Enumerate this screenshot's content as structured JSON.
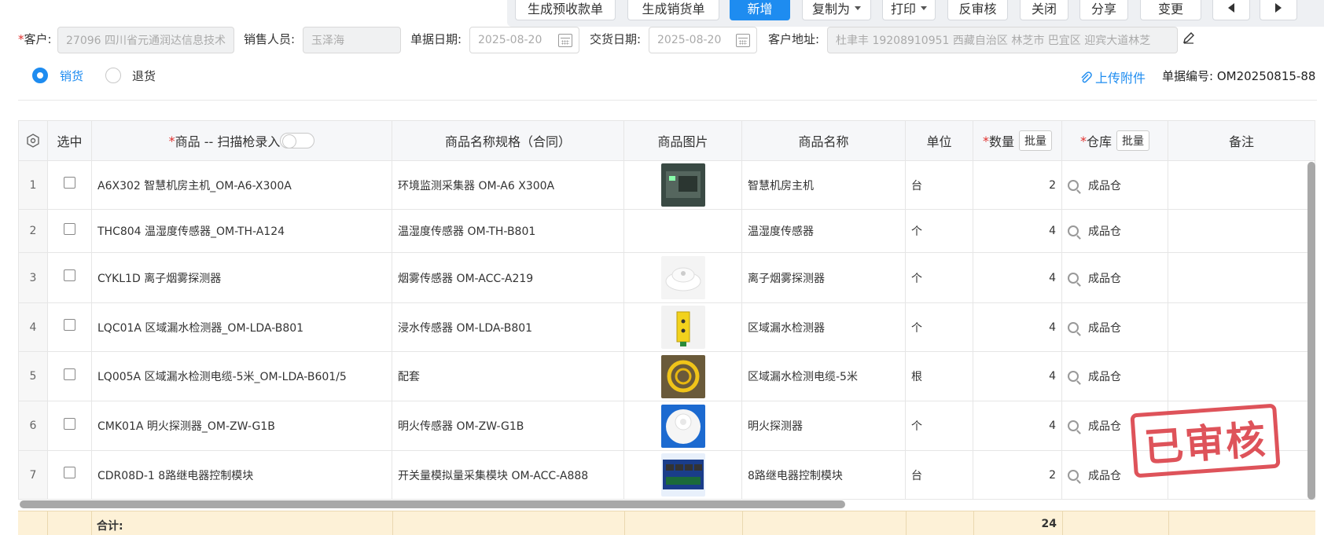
{
  "toolbar": {
    "gen_prereceipt": "生成预收款单",
    "gen_delivery": "生成销货单",
    "new": "新增",
    "copy_as": "复制为",
    "print": "打印",
    "unaudit": "反审核",
    "close": "关闭",
    "share": "分享",
    "change": "变更"
  },
  "form": {
    "customer_label": "客户:",
    "customer_value": "27096 四川省元通润达信息技术",
    "sales_label": "销售人员:",
    "sales_value": "玉泽海",
    "doc_date_label": "单据日期:",
    "doc_date_value": "2025-08-20",
    "delivery_date_label": "交货日期:",
    "delivery_date_value": "2025-08-20",
    "address_label": "客户地址:",
    "address_value": "杜聿丰 19208910951 西藏自治区 林芝市 巴宜区 迎宾大道林芝"
  },
  "mode": {
    "sale": "销货",
    "return": "退货",
    "selected": "sale"
  },
  "attach_label": "上传附件",
  "bill_no": "单据编号: OM20250815-88",
  "table": {
    "headers": {
      "select": "选中",
      "product": "商品 -- 扫描枪录入",
      "spec": "商品名称规格（合同）",
      "image": "商品图片",
      "name": "商品名称",
      "unit": "单位",
      "qty": "数量",
      "warehouse": "仓库",
      "remark": "备注",
      "batch": "批量"
    },
    "rows": [
      {
        "idx": "1",
        "product": "A6X302 智慧机房主机_OM-A6-X300A",
        "spec": "环境监测采集器 OM-A6 X300A",
        "name": "智慧机房主机",
        "unit": "台",
        "qty": "2",
        "warehouse": "成品仓",
        "image": "device-photo"
      },
      {
        "idx": "2",
        "product": "THC804 温湿度传感器_OM-TH-A124",
        "spec": "温湿度传感器 OM-TH-B801",
        "name": "温湿度传感器",
        "unit": "个",
        "qty": "4",
        "warehouse": "成品仓",
        "image": ""
      },
      {
        "idx": "3",
        "product": "CYKL1D 离子烟雾探测器",
        "spec": "烟雾传感器 OM-ACC-A219",
        "name": "离子烟雾探测器",
        "unit": "个",
        "qty": "4",
        "warehouse": "成品仓",
        "image": "smoke-detector-photo"
      },
      {
        "idx": "4",
        "product": "LQC01A 区域漏水检测器_OM-LDA-B801",
        "spec": "浸水传感器 OM-LDA-B801",
        "name": "区域漏水检测器",
        "unit": "个",
        "qty": "4",
        "warehouse": "成品仓",
        "image": "leak-detector-photo"
      },
      {
        "idx": "5",
        "product": "LQ005A 区域漏水检测电缆-5米_OM-LDA-B601/5",
        "spec": "配套",
        "name": "区域漏水检测电缆-5米",
        "unit": "根",
        "qty": "4",
        "warehouse": "成品仓",
        "image": "cable-photo"
      },
      {
        "idx": "6",
        "product": "CMK01A 明火探测器_OM-ZW-G1B",
        "spec": "明火传感器 OM-ZW-G1B",
        "name": "明火探测器",
        "unit": "个",
        "qty": "4",
        "warehouse": "成品仓",
        "image": "flame-detector-photo"
      },
      {
        "idx": "7",
        "product": "CDR08D-1 8路继电器控制模块",
        "spec": "开关量模拟量采集模块 OM-ACC-A888",
        "name": "8路继电器控制模块",
        "unit": "台",
        "qty": "2",
        "warehouse": "成品仓",
        "image": "relay-module-photo"
      }
    ],
    "total_label": "合计:",
    "total_qty": "24"
  },
  "stamp": "已审核",
  "colors": {
    "primary": "#1e8cf0",
    "required": "#e0302e",
    "stamp": "#d9363e",
    "total_bg": "#fdf1d7"
  }
}
